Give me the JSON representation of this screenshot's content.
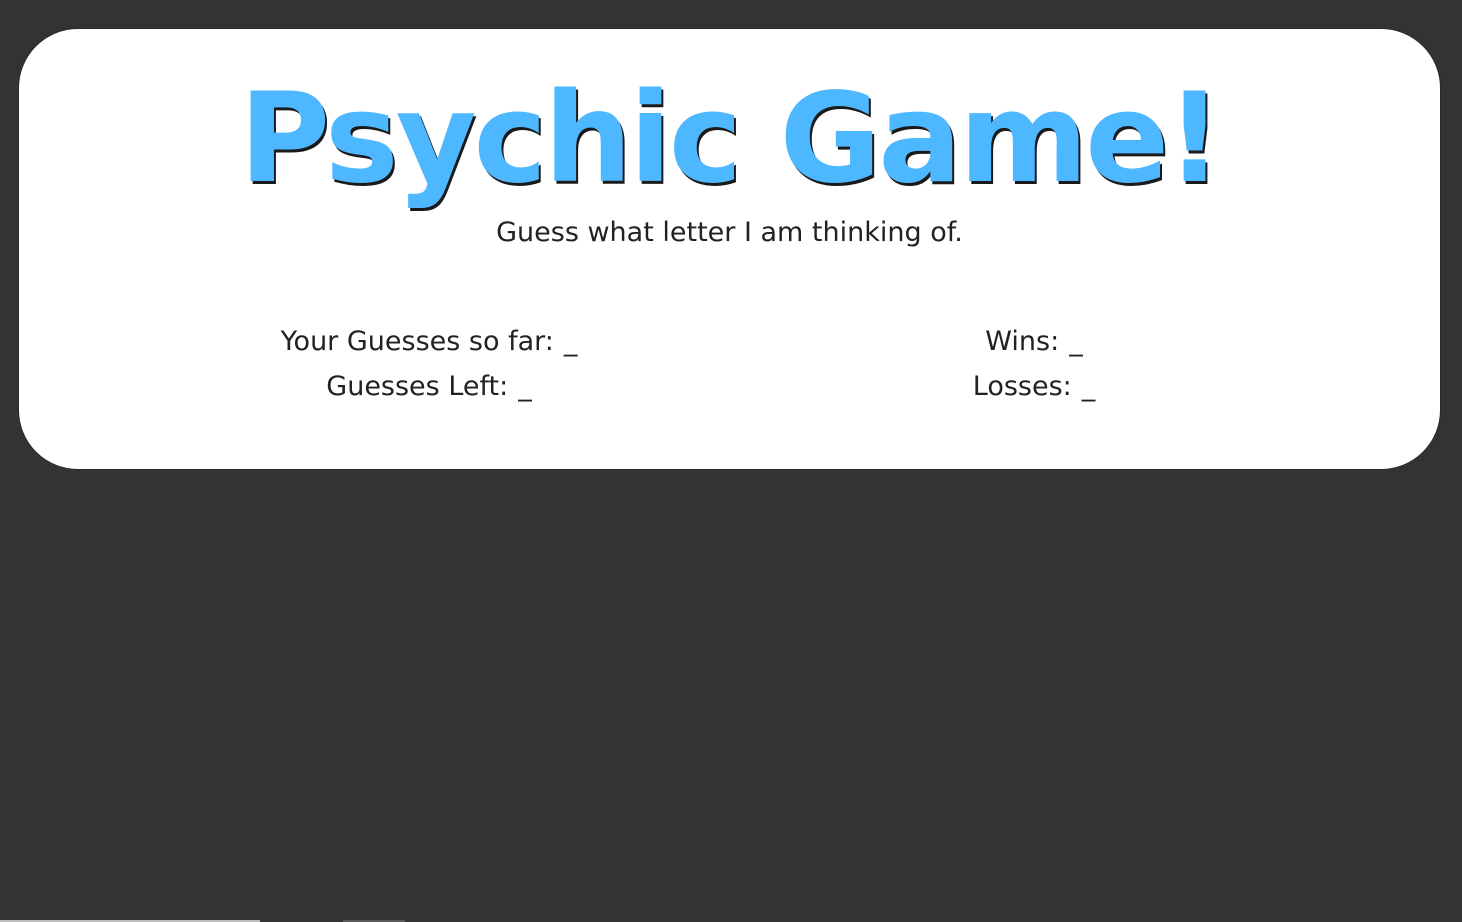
{
  "header": {
    "title": "Psychic Game!",
    "subtitle": "Guess what letter I am thinking of."
  },
  "stats": {
    "guesses_so_far_label": "Your Guesses so far:",
    "guesses_so_far_value": "_",
    "guesses_left_label": "Guesses Left:",
    "guesses_left_value": "_",
    "wins_label": "Wins:",
    "wins_value": "_",
    "losses_label": "Losses:",
    "losses_value": "_"
  },
  "colors": {
    "background": "#333333",
    "card": "#ffffff",
    "title": "#4db8ff",
    "text": "#222222"
  }
}
